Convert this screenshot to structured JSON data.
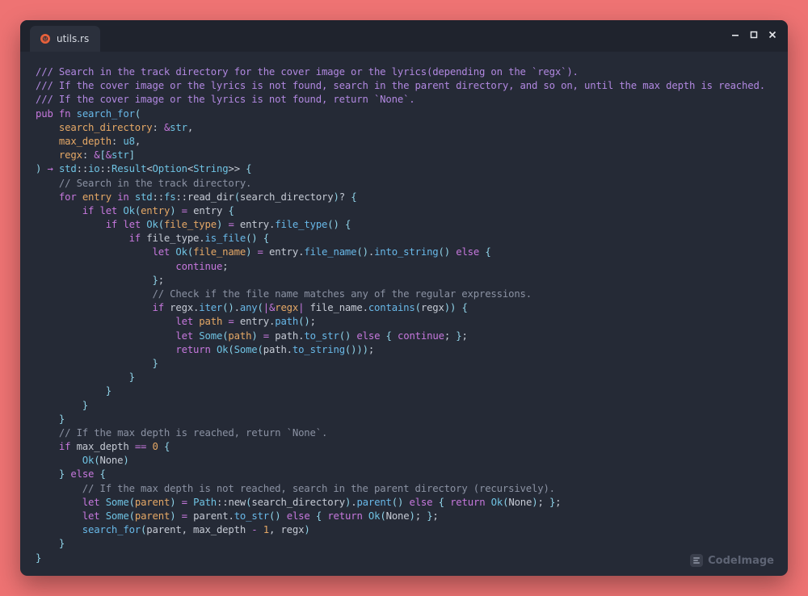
{
  "tab": {
    "label": "utils.rs",
    "icon": "rust-crab-icon",
    "icon_color": "#e8613b"
  },
  "window_controls": {
    "minimize": "minimize-icon",
    "maximize": "maximize-icon",
    "close": "close-icon"
  },
  "brand": {
    "label": "CodeImage",
    "icon": "codeimage-logo-icon"
  },
  "colors": {
    "background": "#ee7373",
    "window": "#252a36",
    "comment": "#8b92a3",
    "doc_comment": "#b188e0",
    "keyword": "#c678dd",
    "function": "#68b8e8",
    "type": "#6fc3e3",
    "parameter": "#e5a866",
    "number": "#e5a866",
    "text": "#c5cad4"
  },
  "code_lines": [
    [
      [
        "doc",
        "/// Search in the track directory for the cover image or the lyrics(depending on the `regx`)."
      ]
    ],
    [
      [
        "doc",
        "/// If the cover image or the lyrics is not found, search in the parent directory, and so on, until the max depth is reached."
      ]
    ],
    [
      [
        "doc",
        "/// If the cover image or the lyrics is not found, return `None`."
      ]
    ],
    [
      [
        "kw",
        "pub"
      ],
      [
        "plain",
        " "
      ],
      [
        "kw",
        "fn"
      ],
      [
        "plain",
        " "
      ],
      [
        "fn",
        "search_for"
      ],
      [
        "punct",
        "("
      ]
    ],
    [
      [
        "plain",
        "    "
      ],
      [
        "param",
        "search_directory"
      ],
      [
        "plain",
        ": "
      ],
      [
        "op",
        "&"
      ],
      [
        "type",
        "str"
      ],
      [
        "plain",
        ","
      ]
    ],
    [
      [
        "plain",
        "    "
      ],
      [
        "param",
        "max_depth"
      ],
      [
        "plain",
        ": "
      ],
      [
        "type",
        "u8"
      ],
      [
        "plain",
        ","
      ]
    ],
    [
      [
        "plain",
        "    "
      ],
      [
        "param",
        "regx"
      ],
      [
        "plain",
        ": "
      ],
      [
        "op",
        "&"
      ],
      [
        "punct",
        "["
      ],
      [
        "op",
        "&"
      ],
      [
        "type",
        "str"
      ],
      [
        "punct",
        "]"
      ]
    ],
    [
      [
        "punct",
        ")"
      ],
      [
        "plain",
        " "
      ],
      [
        "op",
        "→"
      ],
      [
        "plain",
        " "
      ],
      [
        "mod",
        "std"
      ],
      [
        "plain",
        "::"
      ],
      [
        "mod",
        "io"
      ],
      [
        "plain",
        "::"
      ],
      [
        "type",
        "Result"
      ],
      [
        "plain",
        "<"
      ],
      [
        "type",
        "Option"
      ],
      [
        "plain",
        "<"
      ],
      [
        "type",
        "String"
      ],
      [
        "plain",
        ">>"
      ],
      [
        "plain",
        " "
      ],
      [
        "punct",
        "{"
      ]
    ],
    [
      [
        "plain",
        "    "
      ],
      [
        "comment",
        "// Search in the track directory."
      ]
    ],
    [
      [
        "plain",
        "    "
      ],
      [
        "kw",
        "for"
      ],
      [
        "plain",
        " "
      ],
      [
        "param",
        "entry"
      ],
      [
        "plain",
        " "
      ],
      [
        "kw",
        "in"
      ],
      [
        "plain",
        " "
      ],
      [
        "mod",
        "std"
      ],
      [
        "plain",
        "::"
      ],
      [
        "mod",
        "fs"
      ],
      [
        "plain",
        "::"
      ],
      [
        "plain",
        "read_dir"
      ],
      [
        "punct",
        "("
      ],
      [
        "plain",
        "search_directory"
      ],
      [
        "punct",
        ")"
      ],
      [
        "plain",
        "? "
      ],
      [
        "punct",
        "{"
      ]
    ],
    [
      [
        "plain",
        "        "
      ],
      [
        "kw",
        "if"
      ],
      [
        "plain",
        " "
      ],
      [
        "kw",
        "let"
      ],
      [
        "plain",
        " "
      ],
      [
        "type",
        "Ok"
      ],
      [
        "punct",
        "("
      ],
      [
        "param",
        "entry"
      ],
      [
        "punct",
        ")"
      ],
      [
        "plain",
        " "
      ],
      [
        "op",
        "="
      ],
      [
        "plain",
        " entry "
      ],
      [
        "punct",
        "{"
      ]
    ],
    [
      [
        "plain",
        "            "
      ],
      [
        "kw",
        "if"
      ],
      [
        "plain",
        " "
      ],
      [
        "kw",
        "let"
      ],
      [
        "plain",
        " "
      ],
      [
        "type",
        "Ok"
      ],
      [
        "punct",
        "("
      ],
      [
        "param",
        "file_type"
      ],
      [
        "punct",
        ")"
      ],
      [
        "plain",
        " "
      ],
      [
        "op",
        "="
      ],
      [
        "plain",
        " entry."
      ],
      [
        "fn",
        "file_type"
      ],
      [
        "punct",
        "()"
      ],
      [
        "plain",
        " "
      ],
      [
        "punct",
        "{"
      ]
    ],
    [
      [
        "plain",
        "                "
      ],
      [
        "kw",
        "if"
      ],
      [
        "plain",
        " file_type."
      ],
      [
        "fn",
        "is_file"
      ],
      [
        "punct",
        "()"
      ],
      [
        "plain",
        " "
      ],
      [
        "punct",
        "{"
      ]
    ],
    [
      [
        "plain",
        "                    "
      ],
      [
        "kw",
        "let"
      ],
      [
        "plain",
        " "
      ],
      [
        "type",
        "Ok"
      ],
      [
        "punct",
        "("
      ],
      [
        "param",
        "file_name"
      ],
      [
        "punct",
        ")"
      ],
      [
        "plain",
        " "
      ],
      [
        "op",
        "="
      ],
      [
        "plain",
        " entry."
      ],
      [
        "fn",
        "file_name"
      ],
      [
        "punct",
        "()"
      ],
      [
        "plain",
        "."
      ],
      [
        "fn",
        "into_string"
      ],
      [
        "punct",
        "()"
      ],
      [
        "plain",
        " "
      ],
      [
        "kw",
        "else"
      ],
      [
        "plain",
        " "
      ],
      [
        "punct",
        "{"
      ]
    ],
    [
      [
        "plain",
        "                        "
      ],
      [
        "kw",
        "continue"
      ],
      [
        "plain",
        ";"
      ]
    ],
    [
      [
        "plain",
        "                    "
      ],
      [
        "punct",
        "}"
      ],
      [
        "plain",
        ";"
      ]
    ],
    [
      [
        "plain",
        "                    "
      ],
      [
        "comment",
        "// Check if the file name matches any of the regular expressions."
      ]
    ],
    [
      [
        "plain",
        "                    "
      ],
      [
        "kw",
        "if"
      ],
      [
        "plain",
        " regx."
      ],
      [
        "fn",
        "iter"
      ],
      [
        "punct",
        "()"
      ],
      [
        "plain",
        "."
      ],
      [
        "fn",
        "any"
      ],
      [
        "punct",
        "("
      ],
      [
        "op",
        "|&"
      ],
      [
        "param",
        "regx"
      ],
      [
        "op",
        "|"
      ],
      [
        "plain",
        " file_name."
      ],
      [
        "fn",
        "contains"
      ],
      [
        "punct",
        "("
      ],
      [
        "plain",
        "regx"
      ],
      [
        "punct",
        "))"
      ],
      [
        "plain",
        " "
      ],
      [
        "punct",
        "{"
      ]
    ],
    [
      [
        "plain",
        "                        "
      ],
      [
        "kw",
        "let"
      ],
      [
        "plain",
        " "
      ],
      [
        "param",
        "path"
      ],
      [
        "plain",
        " "
      ],
      [
        "op",
        "="
      ],
      [
        "plain",
        " entry."
      ],
      [
        "fn",
        "path"
      ],
      [
        "punct",
        "()"
      ],
      [
        "plain",
        ";"
      ]
    ],
    [
      [
        "plain",
        "                        "
      ],
      [
        "kw",
        "let"
      ],
      [
        "plain",
        " "
      ],
      [
        "type",
        "Some"
      ],
      [
        "punct",
        "("
      ],
      [
        "param",
        "path"
      ],
      [
        "punct",
        ")"
      ],
      [
        "plain",
        " "
      ],
      [
        "op",
        "="
      ],
      [
        "plain",
        " path."
      ],
      [
        "fn",
        "to_str"
      ],
      [
        "punct",
        "()"
      ],
      [
        "plain",
        " "
      ],
      [
        "kw",
        "else"
      ],
      [
        "plain",
        " "
      ],
      [
        "punct",
        "{"
      ],
      [
        "plain",
        " "
      ],
      [
        "kw",
        "continue"
      ],
      [
        "plain",
        "; "
      ],
      [
        "punct",
        "}"
      ],
      [
        "plain",
        ";"
      ]
    ],
    [
      [
        "plain",
        "                        "
      ],
      [
        "kw",
        "return"
      ],
      [
        "plain",
        " "
      ],
      [
        "type",
        "Ok"
      ],
      [
        "punct",
        "("
      ],
      [
        "type",
        "Some"
      ],
      [
        "punct",
        "("
      ],
      [
        "plain",
        "path."
      ],
      [
        "fn",
        "to_string"
      ],
      [
        "punct",
        "()))"
      ],
      [
        "plain",
        ";"
      ]
    ],
    [
      [
        "plain",
        "                    "
      ],
      [
        "punct",
        "}"
      ]
    ],
    [
      [
        "plain",
        "                "
      ],
      [
        "punct",
        "}"
      ]
    ],
    [
      [
        "plain",
        "            "
      ],
      [
        "punct",
        "}"
      ]
    ],
    [
      [
        "plain",
        "        "
      ],
      [
        "punct",
        "}"
      ]
    ],
    [
      [
        "plain",
        "    "
      ],
      [
        "punct",
        "}"
      ]
    ],
    [
      [
        "plain",
        "    "
      ],
      [
        "comment",
        "// If the max depth is reached, return `None`."
      ]
    ],
    [
      [
        "plain",
        "    "
      ],
      [
        "kw",
        "if"
      ],
      [
        "plain",
        " max_depth "
      ],
      [
        "op",
        "=="
      ],
      [
        "plain",
        " "
      ],
      [
        "num",
        "0"
      ],
      [
        "plain",
        " "
      ],
      [
        "punct",
        "{"
      ]
    ],
    [
      [
        "plain",
        "        "
      ],
      [
        "type",
        "Ok"
      ],
      [
        "punct",
        "("
      ],
      [
        "plain",
        "None"
      ],
      [
        "punct",
        ")"
      ]
    ],
    [
      [
        "plain",
        "    "
      ],
      [
        "punct",
        "}"
      ],
      [
        "plain",
        " "
      ],
      [
        "kw",
        "else"
      ],
      [
        "plain",
        " "
      ],
      [
        "punct",
        "{"
      ]
    ],
    [
      [
        "plain",
        "        "
      ],
      [
        "comment",
        "// If the max depth is not reached, search in the parent directory (recursively)."
      ]
    ],
    [
      [
        "plain",
        "        "
      ],
      [
        "kw",
        "let"
      ],
      [
        "plain",
        " "
      ],
      [
        "type",
        "Some"
      ],
      [
        "punct",
        "("
      ],
      [
        "param",
        "parent"
      ],
      [
        "punct",
        ")"
      ],
      [
        "plain",
        " "
      ],
      [
        "op",
        "="
      ],
      [
        "plain",
        " "
      ],
      [
        "type",
        "Path"
      ],
      [
        "plain",
        "::new"
      ],
      [
        "punct",
        "("
      ],
      [
        "plain",
        "search_directory"
      ],
      [
        "punct",
        ")"
      ],
      [
        "plain",
        "."
      ],
      [
        "fn",
        "parent"
      ],
      [
        "punct",
        "()"
      ],
      [
        "plain",
        " "
      ],
      [
        "kw",
        "else"
      ],
      [
        "plain",
        " "
      ],
      [
        "punct",
        "{"
      ],
      [
        "plain",
        " "
      ],
      [
        "kw",
        "return"
      ],
      [
        "plain",
        " "
      ],
      [
        "type",
        "Ok"
      ],
      [
        "punct",
        "("
      ],
      [
        "plain",
        "None"
      ],
      [
        "punct",
        ")"
      ],
      [
        "plain",
        "; "
      ],
      [
        "punct",
        "}"
      ],
      [
        "plain",
        ";"
      ]
    ],
    [
      [
        "plain",
        "        "
      ],
      [
        "kw",
        "let"
      ],
      [
        "plain",
        " "
      ],
      [
        "type",
        "Some"
      ],
      [
        "punct",
        "("
      ],
      [
        "param",
        "parent"
      ],
      [
        "punct",
        ")"
      ],
      [
        "plain",
        " "
      ],
      [
        "op",
        "="
      ],
      [
        "plain",
        " parent."
      ],
      [
        "fn",
        "to_str"
      ],
      [
        "punct",
        "()"
      ],
      [
        "plain",
        " "
      ],
      [
        "kw",
        "else"
      ],
      [
        "plain",
        " "
      ],
      [
        "punct",
        "{"
      ],
      [
        "plain",
        " "
      ],
      [
        "kw",
        "return"
      ],
      [
        "plain",
        " "
      ],
      [
        "type",
        "Ok"
      ],
      [
        "punct",
        "("
      ],
      [
        "plain",
        "None"
      ],
      [
        "punct",
        ")"
      ],
      [
        "plain",
        "; "
      ],
      [
        "punct",
        "}"
      ],
      [
        "plain",
        ";"
      ]
    ],
    [
      [
        "plain",
        "        "
      ],
      [
        "fn",
        "search_for"
      ],
      [
        "punct",
        "("
      ],
      [
        "plain",
        "parent, max_depth "
      ],
      [
        "op",
        "-"
      ],
      [
        "plain",
        " "
      ],
      [
        "num",
        "1"
      ],
      [
        "plain",
        ", regx"
      ],
      [
        "punct",
        ")"
      ]
    ],
    [
      [
        "plain",
        "    "
      ],
      [
        "punct",
        "}"
      ]
    ],
    [
      [
        "punct",
        "}"
      ]
    ]
  ]
}
